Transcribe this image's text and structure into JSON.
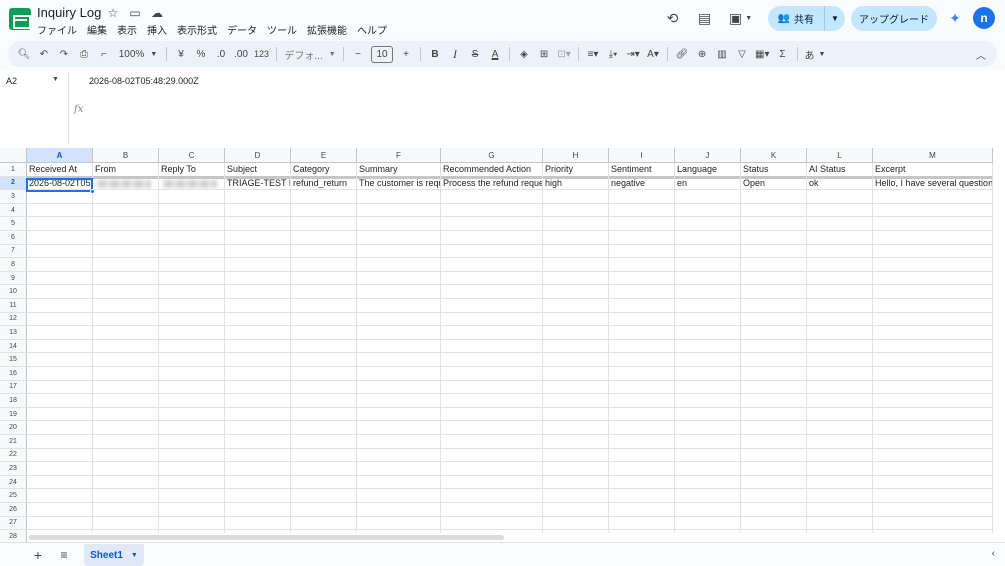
{
  "document": {
    "title": "Inquiry Log",
    "title_icons": [
      "star-icon",
      "folder-move-icon",
      "cloud-status-icon"
    ]
  },
  "menu": [
    "ファイル",
    "編集",
    "表示",
    "挿入",
    "表示形式",
    "データ",
    "ツール",
    "拡張機能",
    "ヘルプ"
  ],
  "topbar": {
    "share_label": "共有",
    "upgrade_label": "アップグレード",
    "avatar_letter": "n"
  },
  "toolbar": {
    "zoom": "100%",
    "currency": "¥",
    "percent": "%",
    "decimal_decrease": ".0",
    "decimal_increase": ".00",
    "number_format": "123",
    "font": "デフォ...",
    "font_size": "10",
    "input_method": "あ"
  },
  "formula_bar": {
    "cell_ref": "A2",
    "fx": "fx",
    "value": "2026-08-02T05:48:29.000Z"
  },
  "grid": {
    "selected_cell": "A2",
    "columns": [
      "A",
      "B",
      "C",
      "D",
      "E",
      "F",
      "G",
      "H",
      "I",
      "J",
      "K",
      "L",
      "M"
    ],
    "header_row": [
      "Received At",
      "From",
      "Reply To",
      "Subject",
      "Category",
      "Summary",
      "Recommended Action",
      "Priority",
      "Sentiment",
      "Language",
      "Status",
      "AI Status",
      "Excerpt"
    ],
    "data_rows": [
      [
        "2026-08-02T05:48:29.000Z",
        "",
        "",
        "TRIAGE-TEST L",
        "refund_return",
        "The customer is requ",
        "Process the refund reques",
        "high",
        "negative",
        "en",
        "Open",
        "ok",
        "Hello, I have several questions abo"
      ]
    ],
    "row_numbers": [
      "1",
      "2",
      "3",
      "4",
      "5",
      "6",
      "7",
      "8",
      "9",
      "10",
      "11",
      "12",
      "13",
      "14",
      "15",
      "16",
      "17",
      "18",
      "19",
      "20",
      "21",
      "22",
      "23",
      "24",
      "25",
      "26",
      "27",
      "28",
      "29"
    ]
  },
  "sheets": {
    "active": "Sheet1"
  }
}
